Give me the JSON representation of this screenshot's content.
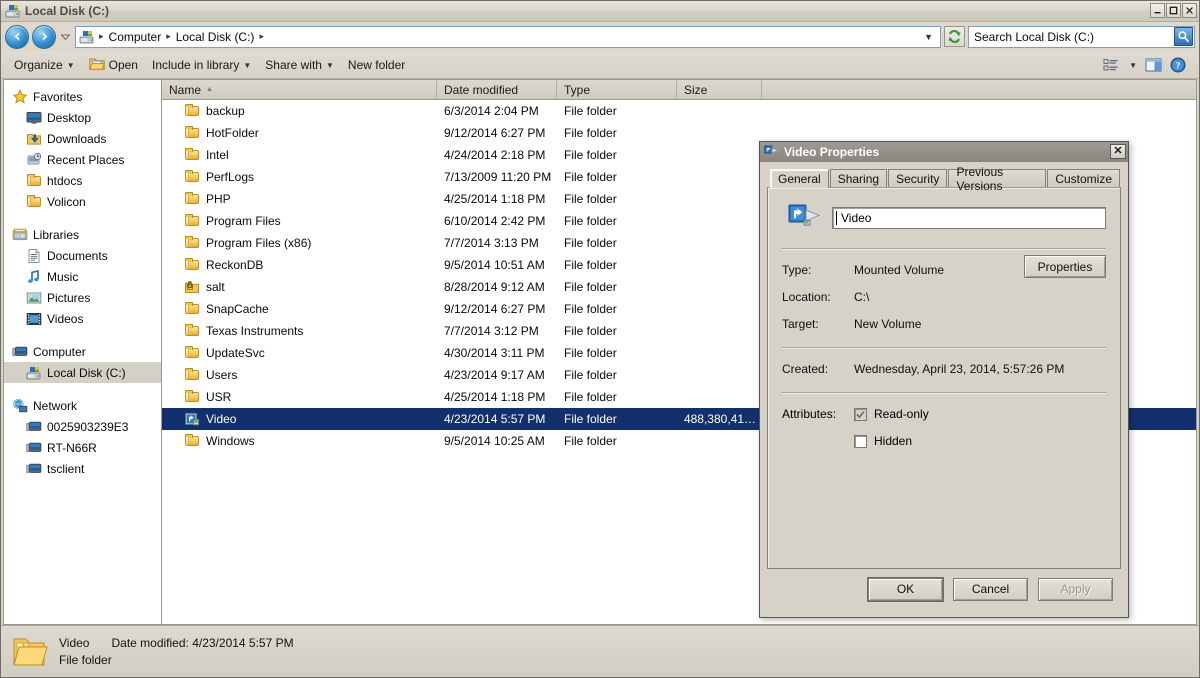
{
  "window": {
    "title": "Local Disk (C:)",
    "icon": "drive-icon",
    "controls": {
      "minimize": "_",
      "maximize": "□",
      "close": "✕"
    }
  },
  "addressbar": {
    "back_tooltip": "Back",
    "forward_tooltip": "Forward",
    "history_tooltip": "Recent pages",
    "breadcrumbs": [
      "Computer",
      "Local Disk (C:)"
    ],
    "separator": "▸",
    "dropdown": "▼",
    "refresh_tooltip": "Refresh"
  },
  "search": {
    "placeholder": "Search Local Disk (C:)",
    "value": "",
    "icon": "search-icon"
  },
  "commandbar": {
    "items": [
      {
        "label": "Organize",
        "has_caret": true,
        "icon": null
      },
      {
        "label": "Open",
        "has_caret": false,
        "icon": "open-folder-icon"
      },
      {
        "label": "Include in library",
        "has_caret": true,
        "icon": null
      },
      {
        "label": "Share with",
        "has_caret": true,
        "icon": null
      },
      {
        "label": "New folder",
        "has_caret": false,
        "icon": null
      }
    ],
    "right": {
      "views_icon": "views-list-icon",
      "views_caret": "▼",
      "preview_pane_icon": "preview-pane-icon",
      "help_icon": "help-icon"
    }
  },
  "sidebar": {
    "groups": [
      {
        "header": {
          "label": "Favorites",
          "icon": "favorites-star-icon"
        },
        "items": [
          {
            "label": "Desktop",
            "icon": "desktop-icon"
          },
          {
            "label": "Downloads",
            "icon": "downloads-icon"
          },
          {
            "label": "Recent Places",
            "icon": "recent-places-icon"
          },
          {
            "label": "htdocs",
            "icon": "folder-icon"
          },
          {
            "label": "Volicon",
            "icon": "folder-icon"
          }
        ]
      },
      {
        "header": {
          "label": "Libraries",
          "icon": "libraries-icon"
        },
        "items": [
          {
            "label": "Documents",
            "icon": "documents-icon"
          },
          {
            "label": "Music",
            "icon": "music-icon"
          },
          {
            "label": "Pictures",
            "icon": "pictures-icon"
          },
          {
            "label": "Videos",
            "icon": "videos-icon"
          }
        ]
      },
      {
        "header": {
          "label": "Computer",
          "icon": "computer-icon"
        },
        "items": [
          {
            "label": "Local Disk (C:)",
            "icon": "drive-icon",
            "selected": true
          }
        ]
      },
      {
        "header": {
          "label": "Network",
          "icon": "network-icon"
        },
        "items": [
          {
            "label": "0025903239E3",
            "icon": "computer-icon"
          },
          {
            "label": "RT-N66R",
            "icon": "computer-icon"
          },
          {
            "label": "tsclient",
            "icon": "computer-icon"
          }
        ]
      }
    ]
  },
  "filelist": {
    "columns": [
      {
        "label": "Name",
        "sorted": true,
        "sort_arrow": "▲"
      },
      {
        "label": "Date modified"
      },
      {
        "label": "Type"
      },
      {
        "label": "Size"
      }
    ],
    "rows": [
      {
        "name": "backup",
        "date": "6/3/2014 2:04 PM",
        "type": "File folder",
        "size": "",
        "icon": "folder-icon"
      },
      {
        "name": "HotFolder",
        "date": "9/12/2014 6:27 PM",
        "type": "File folder",
        "size": "",
        "icon": "folder-icon"
      },
      {
        "name": "Intel",
        "date": "4/24/2014 2:18 PM",
        "type": "File folder",
        "size": "",
        "icon": "folder-icon"
      },
      {
        "name": "PerfLogs",
        "date": "7/13/2009 11:20 PM",
        "type": "File folder",
        "size": "",
        "icon": "folder-icon"
      },
      {
        "name": "PHP",
        "date": "4/25/2014 1:18 PM",
        "type": "File folder",
        "size": "",
        "icon": "folder-icon"
      },
      {
        "name": "Program Files",
        "date": "6/10/2014 2:42 PM",
        "type": "File folder",
        "size": "",
        "icon": "folder-icon"
      },
      {
        "name": "Program Files (x86)",
        "date": "7/7/2014 3:13 PM",
        "type": "File folder",
        "size": "",
        "icon": "folder-icon"
      },
      {
        "name": "ReckonDB",
        "date": "9/5/2014 10:51 AM",
        "type": "File folder",
        "size": "",
        "icon": "folder-icon"
      },
      {
        "name": "salt",
        "date": "8/28/2014 9:12 AM",
        "type": "File folder",
        "size": "",
        "icon": "folder-locked-icon"
      },
      {
        "name": "SnapCache",
        "date": "9/12/2014 6:27 PM",
        "type": "File folder",
        "size": "",
        "icon": "folder-icon"
      },
      {
        "name": "Texas Instruments",
        "date": "7/7/2014 3:12 PM",
        "type": "File folder",
        "size": "",
        "icon": "folder-icon"
      },
      {
        "name": "UpdateSvc",
        "date": "4/30/2014 3:11 PM",
        "type": "File folder",
        "size": "",
        "icon": "folder-icon"
      },
      {
        "name": "Users",
        "date": "4/23/2014 9:17 AM",
        "type": "File folder",
        "size": "",
        "icon": "folder-icon"
      },
      {
        "name": "USR",
        "date": "4/25/2014 1:18 PM",
        "type": "File folder",
        "size": "",
        "icon": "folder-icon"
      },
      {
        "name": "Video",
        "date": "4/23/2014 5:57 PM",
        "type": "File folder",
        "size": "488,380,41…",
        "icon": "mounted-volume-icon",
        "selected": true
      },
      {
        "name": "Windows",
        "date": "9/5/2014 10:25 AM",
        "type": "File folder",
        "size": "",
        "icon": "folder-icon"
      }
    ]
  },
  "statusbar": {
    "icon": "folder-large-icon",
    "name": "Video",
    "date_label": "Date modified:",
    "date_value": "4/23/2014 5:57 PM",
    "type": "File folder"
  },
  "dialog": {
    "title": "Video Properties",
    "icon": "shortcut-volume-icon",
    "close_label": "✕",
    "tabs": [
      {
        "label": "General",
        "active": true
      },
      {
        "label": "Sharing",
        "active": false
      },
      {
        "label": "Security",
        "active": false
      },
      {
        "label": "Previous Versions",
        "active": false
      },
      {
        "label": "Customize",
        "active": false
      }
    ],
    "general": {
      "name_value": "Video",
      "fields": [
        {
          "label": "Type:",
          "value": "Mounted Volume"
        },
        {
          "label": "Location:",
          "value": "C:\\"
        },
        {
          "label": "Target:",
          "value": "New Volume"
        }
      ],
      "properties_button": "Properties",
      "created_label": "Created:",
      "created_value": "Wednesday, April 23, 2014, 5:57:26 PM",
      "attributes_label": "Attributes:",
      "attributes": [
        {
          "label": "Read-only",
          "state": "mixed"
        },
        {
          "label": "Hidden",
          "state": "unchecked"
        }
      ]
    },
    "buttons": [
      {
        "label": "OK",
        "enabled": true,
        "default": true
      },
      {
        "label": "Cancel",
        "enabled": true,
        "default": false
      },
      {
        "label": "Apply",
        "enabled": false,
        "default": false
      }
    ]
  },
  "colors": {
    "selection": "#12306b",
    "chrome": "#d6d2c8",
    "title_text": "#4b4b49"
  }
}
